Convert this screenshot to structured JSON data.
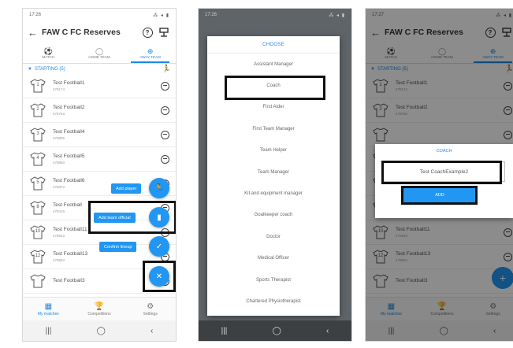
{
  "screen1": {
    "status_time": "17:26",
    "status_right": "⁂ ◂ ▮",
    "back_icon": "←",
    "title": "FAW C FC Reserves",
    "tabs": [
      {
        "label": "MATCH",
        "icon": "⚽"
      },
      {
        "label": "HOME TEAM",
        "icon": "◯"
      },
      {
        "label": "AWAY TEAM",
        "icon": "⊕"
      }
    ],
    "section_label": "STARTING (5)",
    "players": [
      {
        "name": "Test Football1",
        "id": "478174",
        "num": "1"
      },
      {
        "name": "Test Football2",
        "id": "478763",
        "num": "2"
      },
      {
        "name": "Test Football4",
        "id": "478855",
        "num": "3"
      },
      {
        "name": "Test Football5",
        "id": "478850",
        "num": "4"
      },
      {
        "name": "Test Football6",
        "id": "478873",
        "num": "5"
      },
      {
        "name": "Test Football",
        "id": "478416",
        "num": "8"
      },
      {
        "name": "Test Football11",
        "id": "478933",
        "num": "10"
      },
      {
        "name": "Test Football13",
        "id": "478894",
        "num": "12"
      },
      {
        "name": "Test Football3",
        "id": "",
        "num": ""
      }
    ],
    "fab_menu": {
      "add_player": "Add player",
      "add_team_official": "Add team official",
      "confirm_lineup": "Confirm lineup"
    },
    "nav": [
      {
        "label": "My matches",
        "icon": "▦"
      },
      {
        "label": "Competitions",
        "icon": "🏆"
      },
      {
        "label": "Settings",
        "icon": "⚙"
      }
    ],
    "sysnav": [
      "|||",
      "◯",
      "‹"
    ]
  },
  "screen2": {
    "status_time": "17:26",
    "status_right": "⁂ ◂ ▮",
    "chooser_title": "CHOOSE",
    "options": [
      "Assistant Manager",
      "Coach",
      "First Aider",
      "First Team Manager",
      "Team Helper",
      "Team Manager",
      "Kit and equipment manager",
      "Goalkeeper coach",
      "Doctor",
      "Medical Officer",
      "Sports Therapist",
      "Chartered Physiotherapist"
    ],
    "sysnav": [
      "|||",
      "◯",
      "‹"
    ]
  },
  "screen3": {
    "status_time": "17:27",
    "status_right": "⁂ ◂ ▮",
    "title": "FAW C FC Reserves",
    "tabs": [
      {
        "label": "MATCH",
        "icon": "⚽"
      },
      {
        "label": "HOME TEAM",
        "icon": "◯"
      },
      {
        "label": "AWAY TEAM",
        "icon": "⊕"
      }
    ],
    "section_label": "STARTING (5)",
    "players": [
      {
        "name": "Test Football1",
        "id": "478174",
        "num": "1"
      },
      {
        "name": "Test Football2",
        "id": "478763",
        "num": "2"
      },
      {
        "name": "",
        "id": "",
        "num": ""
      },
      {
        "name": "",
        "id": "",
        "num": ""
      },
      {
        "name": "",
        "id": "",
        "num": ""
      },
      {
        "name": "Test Football10",
        "id": "478916",
        "num": "8"
      },
      {
        "name": "Test Football11",
        "id": "478933",
        "num": "10"
      },
      {
        "name": "Test Football13",
        "id": "478894",
        "num": "12"
      },
      {
        "name": "Test Football3",
        "id": "",
        "num": ""
      }
    ],
    "dialog_title": "COACH",
    "dialog_value": "Test CoachExample2",
    "dialog_button": "ADD",
    "fab_icon": "+",
    "nav": [
      {
        "label": "My matches",
        "icon": "▦"
      },
      {
        "label": "Competitions",
        "icon": "🏆"
      },
      {
        "label": "Settings",
        "icon": "⚙"
      }
    ],
    "sysnav": [
      "|||",
      "◯",
      "‹"
    ]
  },
  "colors": {
    "accent": "#2196f3",
    "accent_text": "#1e88e5",
    "highlight": "#111111"
  }
}
